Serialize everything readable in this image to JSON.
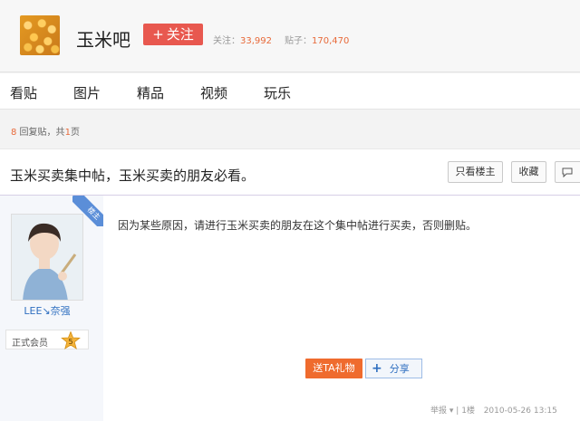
{
  "header": {
    "forum_name": "玉米吧",
    "follow_label": "关注",
    "follow_plus": "+",
    "follow_count_label": "关注：",
    "follow_count": "33,992",
    "post_count_label": "贴子：",
    "post_count": "170,470"
  },
  "nav": {
    "items": [
      {
        "label": "看贴"
      },
      {
        "label": "图片"
      },
      {
        "label": "精品"
      },
      {
        "label": "视频"
      },
      {
        "label": "玩乐"
      }
    ]
  },
  "reply_info": {
    "count": "8",
    "text_mid": " 回复贴，共",
    "pages": "1",
    "text_end": "页"
  },
  "thread": {
    "title": "玉米买卖集中帖，玉米买卖的朋友必看。",
    "only_author_label": "只看楼主",
    "favorite_label": "收藏",
    "reply_icon": "comment-icon"
  },
  "post": {
    "badge_label": "楼主",
    "author_name": "LEE↘奈强",
    "member_label": "正式会员",
    "level": "5",
    "content": "因为某些原因，请进行玉米买卖的朋友在这个集中帖进行买卖，否则删贴。",
    "gift_label": "送TA礼物",
    "share_plus": "+",
    "share_label": "分享",
    "footer": {
      "report": "举报",
      "report_arrow": "▾",
      "separator": "|",
      "floor": "1楼",
      "datetime": "2010-05-26 13:15"
    }
  },
  "colors": {
    "accent_red": "#e8584f",
    "number_orange": "#e86a3a",
    "link_blue": "#2f6fc0",
    "gift_orange": "#ef6b2e"
  }
}
